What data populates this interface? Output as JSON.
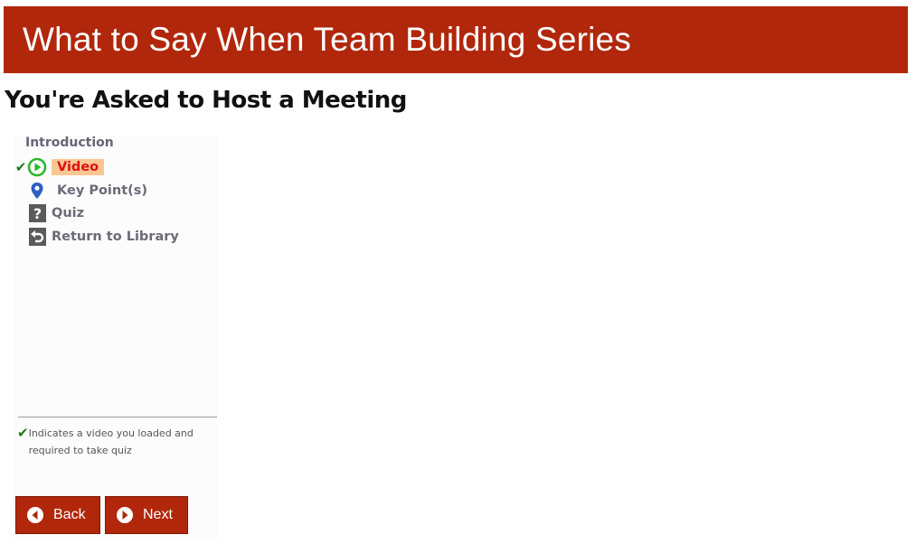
{
  "header": {
    "series_title": "What to Say When Team Building Series"
  },
  "lesson": {
    "title": "You're Asked to Host a Meeting"
  },
  "sidebar": {
    "heading": "Introduction",
    "items": [
      {
        "label": "Video",
        "icon": "play-circle-icon",
        "active": true,
        "checked": true
      },
      {
        "label": "Key Point(s)",
        "icon": "map-pin-icon"
      },
      {
        "label": "Quiz",
        "icon": "question-icon"
      },
      {
        "label": "Return to Library",
        "icon": "return-arrow-icon"
      }
    ],
    "legend_text": "Indicates a video you loaded and required to take quiz"
  },
  "buttons": {
    "back_label": "Back",
    "next_label": "Next"
  },
  "colors": {
    "brand": "#b1270b",
    "video_highlight": "#f9c693",
    "active_text": "#e01010",
    "check": "#1c7a1c",
    "play_icon": "#2cb52c",
    "pin_icon": "#2f5fc4"
  }
}
